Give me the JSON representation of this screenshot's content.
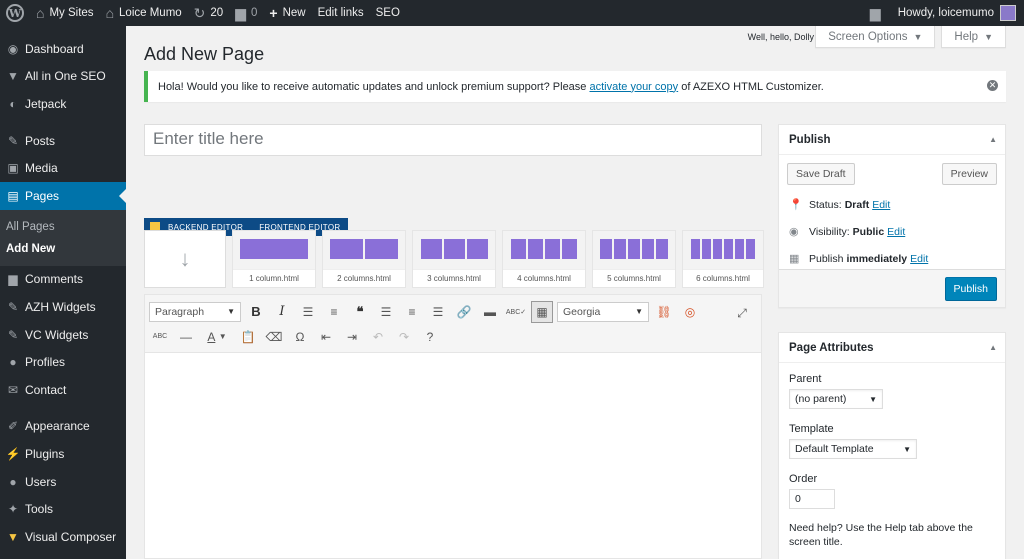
{
  "adminbar": {
    "my_sites": "My Sites",
    "site_name": "Loice Mumo",
    "updates_count": "20",
    "comments_count": "0",
    "new_label": "New",
    "edit_links": "Edit links",
    "seo": "SEO",
    "howdy": "Howdy, loicemumo"
  },
  "sidebar": {
    "items": [
      {
        "label": "Dashboard",
        "icon": "dashboard-icon"
      },
      {
        "label": "All in One SEO",
        "icon": "seo-icon"
      },
      {
        "label": "Jetpack",
        "icon": "jetpack-icon"
      },
      {
        "label": "Posts",
        "icon": "pin-icon"
      },
      {
        "label": "Media",
        "icon": "media-icon"
      },
      {
        "label": "Pages",
        "icon": "pages-icon"
      },
      {
        "label": "Comments",
        "icon": "comments-icon"
      },
      {
        "label": "AZH Widgets",
        "icon": "pin-icon"
      },
      {
        "label": "VC Widgets",
        "icon": "pin-icon"
      },
      {
        "label": "Profiles",
        "icon": "user-icon"
      },
      {
        "label": "Contact",
        "icon": "mail-icon"
      },
      {
        "label": "Appearance",
        "icon": "brush-icon"
      },
      {
        "label": "Plugins",
        "icon": "plugin-icon"
      },
      {
        "label": "Users",
        "icon": "users-icon"
      },
      {
        "label": "Tools",
        "icon": "wrench-icon"
      },
      {
        "label": "Visual Composer",
        "icon": "vc-icon"
      }
    ],
    "submenu": [
      "All Pages",
      "Add New"
    ]
  },
  "header": {
    "hello": "Well, hello, Dolly",
    "screen_options": "Screen Options",
    "help": "Help",
    "page_title": "Add New Page"
  },
  "notice": {
    "text_before": "Hola! Would you like to receive automatic updates and unlock premium support? Please ",
    "link": "activate your copy",
    "text_after": " of AZEXO HTML Customizer."
  },
  "editor": {
    "title_placeholder": "Enter title here",
    "vc_backend": "BACKEND EDITOR",
    "vc_frontend": "FRONTEND EDITOR",
    "templates": [
      {
        "name": "1 column.html",
        "cols": 1
      },
      {
        "name": "2 columns.html",
        "cols": 2
      },
      {
        "name": "3 columns.html",
        "cols": 3
      },
      {
        "name": "4 columns.html",
        "cols": 4
      },
      {
        "name": "5 columns.html",
        "cols": 5
      },
      {
        "name": "6 columns.html",
        "cols": 6
      }
    ],
    "format_select": "Paragraph",
    "font_select": "Georgia"
  },
  "publish": {
    "title": "Publish",
    "save_draft": "Save Draft",
    "preview": "Preview",
    "status_label": "Status:",
    "status_value": "Draft",
    "visibility_label": "Visibility:",
    "visibility_value": "Public",
    "publish_label": "Publish",
    "publish_value": "immediately",
    "edit": "Edit",
    "publish_button": "Publish"
  },
  "page_attributes": {
    "title": "Page Attributes",
    "parent_label": "Parent",
    "parent_value": "(no parent)",
    "template_label": "Template",
    "template_value": "Default Template",
    "order_label": "Order",
    "order_value": "0",
    "help_text": "Need help? Use the Help tab above the screen title."
  },
  "colors": {
    "accent": "#0073aa",
    "sidebar_bg": "#23282d",
    "template_col": "#8a6fd8",
    "notice_border": "#46b450"
  }
}
